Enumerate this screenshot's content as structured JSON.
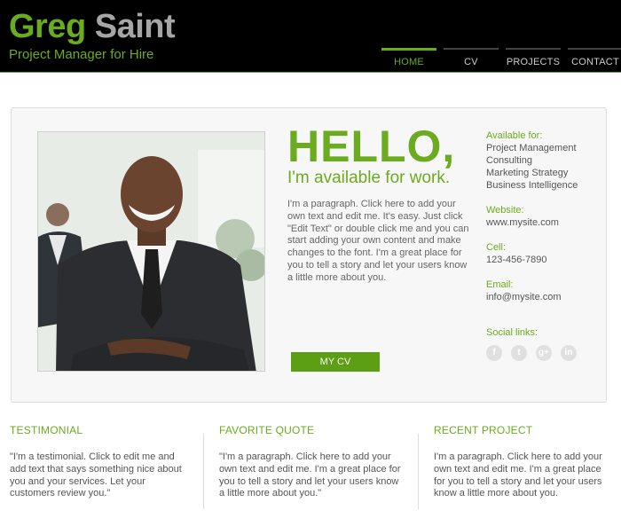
{
  "header": {
    "first_name": "Greg",
    "last_name": "Saint",
    "tagline": "Project Manager for Hire",
    "nav": [
      "HOME",
      "CV",
      "PROJECTS",
      "CONTACT"
    ],
    "active_index": 0
  },
  "hero": {
    "hello": "HELLO,",
    "subhead": "I'm available for work.",
    "intro": "I'm a paragraph. Click here to add your own text and edit me. It's easy. Just click \"Edit Text\" or double click me and you can start adding your own content and make changes to the font. I'm a great place for you to tell a story and let your users know a little more about you.",
    "cv_button": "MY CV"
  },
  "sidebar": {
    "available_label": "Available for:",
    "available_items": [
      "Project Management",
      "Consulting",
      "Marketing Strategy",
      "Business Intelligence"
    ],
    "website_label": "Website:",
    "website_value": "www.mysite.com",
    "cell_label": "Cell:",
    "cell_value": "123-456-7890",
    "email_label": "Email:",
    "email_value": "info@mysite.com",
    "social_label": "Social links:",
    "social_icons": [
      "facebook-icon",
      "twitter-icon",
      "google-plus-icon",
      "linkedin-icon"
    ],
    "social_glyphs": [
      "f",
      "t",
      "g+",
      "in"
    ]
  },
  "sections": [
    {
      "title": "TESTIMONIAL",
      "text": "\"I'm a testimonial. Click to edit me and add text that says something nice about you and your services. Let your customers review you.\""
    },
    {
      "title": "FAVORITE QUOTE",
      "text": "\"I'm a paragraph. Click here to add your own text and edit me. I'm a great place for you to tell a story and let your users know a little more about you.\""
    },
    {
      "title": "RECENT PROJECT",
      "text": "I'm a paragraph. Click here to add your own text and edit me. I'm a great place for you to tell a story and let your users know a little more about you."
    }
  ],
  "colors": {
    "accent": "#6aab1f",
    "button": "#5c9e14",
    "header_bg": "#000000"
  }
}
